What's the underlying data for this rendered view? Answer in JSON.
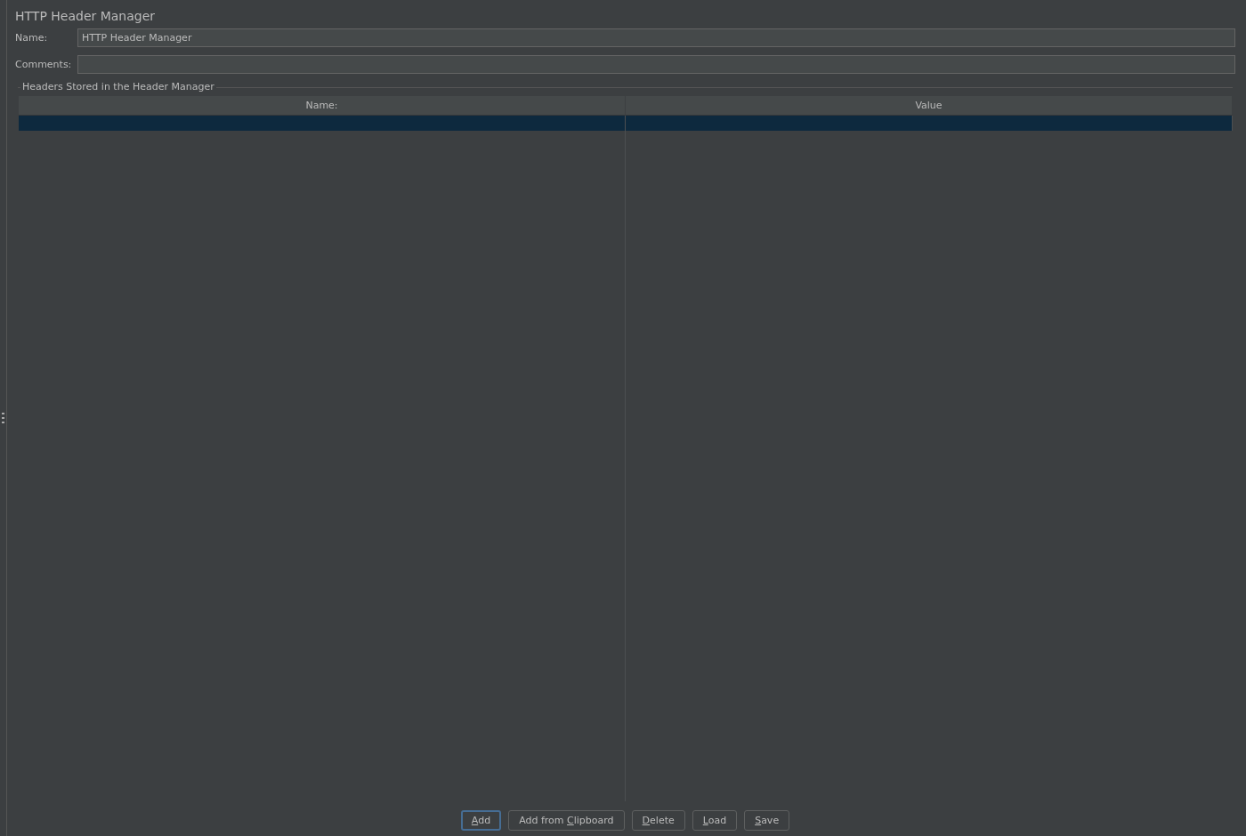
{
  "panel": {
    "title": "HTTP Header Manager"
  },
  "fields": [
    {
      "label": "Name:",
      "value": "HTTP Header Manager"
    },
    {
      "label": "Comments:"
    }
  ],
  "group": {
    "title": "Headers Stored in the Header Manager"
  },
  "table": {
    "columns": [
      "Name:",
      "Value"
    ],
    "rows": [
      {
        "selected": true
      }
    ]
  },
  "buttons": [
    {
      "segments": [
        {
          "text": "A",
          "underlined": true
        },
        {
          "text": "dd",
          "underlined": false
        }
      ],
      "focused": true
    },
    {
      "segments": [
        {
          "text": "Add from ",
          "underlined": false
        },
        {
          "text": "C",
          "underlined": true
        },
        {
          "text": "lipboard",
          "underlined": false
        }
      ],
      "focused": false
    },
    {
      "segments": [
        {
          "text": "D",
          "underlined": true
        },
        {
          "text": "elete",
          "underlined": false
        }
      ],
      "focused": false
    },
    {
      "segments": [
        {
          "text": "L",
          "underlined": true
        },
        {
          "text": "oad",
          "underlined": false
        }
      ],
      "focused": false
    },
    {
      "segments": [
        {
          "text": "S",
          "underlined": true
        },
        {
          "text": "ave",
          "underlined": false
        }
      ],
      "focused": false
    }
  ]
}
